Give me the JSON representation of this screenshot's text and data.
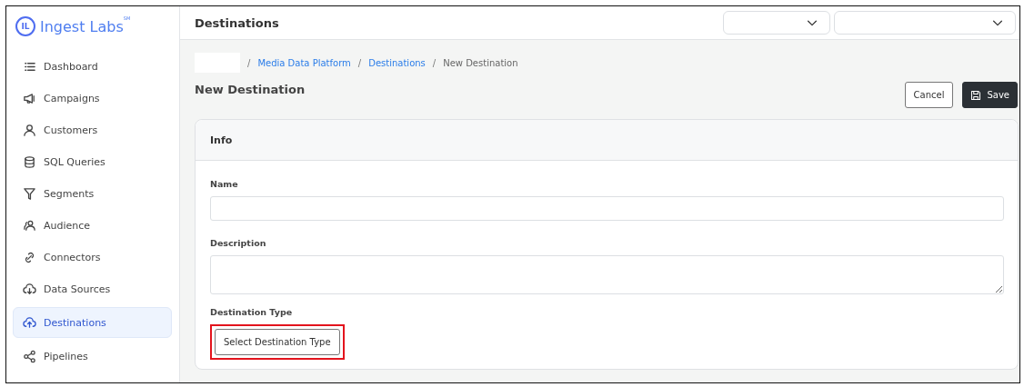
{
  "brand": {
    "name": "Ingest Labs",
    "mark": "SM",
    "logo_letters": "IL"
  },
  "sidebar": {
    "items": [
      {
        "label": "Dashboard",
        "selected": false
      },
      {
        "label": "Campaigns",
        "selected": false
      },
      {
        "label": "Customers",
        "selected": false
      },
      {
        "label": "SQL Queries",
        "selected": false
      },
      {
        "label": "Segments",
        "selected": false
      },
      {
        "label": "Audience",
        "selected": false
      },
      {
        "label": "Connectors",
        "selected": false
      },
      {
        "label": "Data Sources",
        "selected": false
      },
      {
        "label": "Destinations",
        "selected": true
      },
      {
        "label": "Pipelines",
        "selected": false
      }
    ]
  },
  "header": {
    "title": "Destinations",
    "dropdowns": [
      {
        "kind": "select"
      },
      {
        "kind": "select"
      }
    ]
  },
  "breadcrumb": [
    {
      "separator": "/",
      "label": "Media Data Platform",
      "current": false
    },
    {
      "separator": "/",
      "label": "Destinations",
      "current": false
    },
    {
      "separator": "/",
      "label": "New Destination",
      "current": true
    }
  ],
  "page_title": "New Destination",
  "actions": [
    {
      "label": "Cancel",
      "kind": "secondary"
    },
    {
      "label": "Save",
      "kind": "primary"
    }
  ],
  "card": {
    "title": "Info",
    "fields": [
      {
        "label": "Name",
        "kind": "input"
      },
      {
        "label": "Description",
        "kind": "textarea"
      },
      {
        "label": "Destination Type",
        "kind": "button",
        "button": "Select Destination Type",
        "highlighted": true
      }
    ]
  }
}
